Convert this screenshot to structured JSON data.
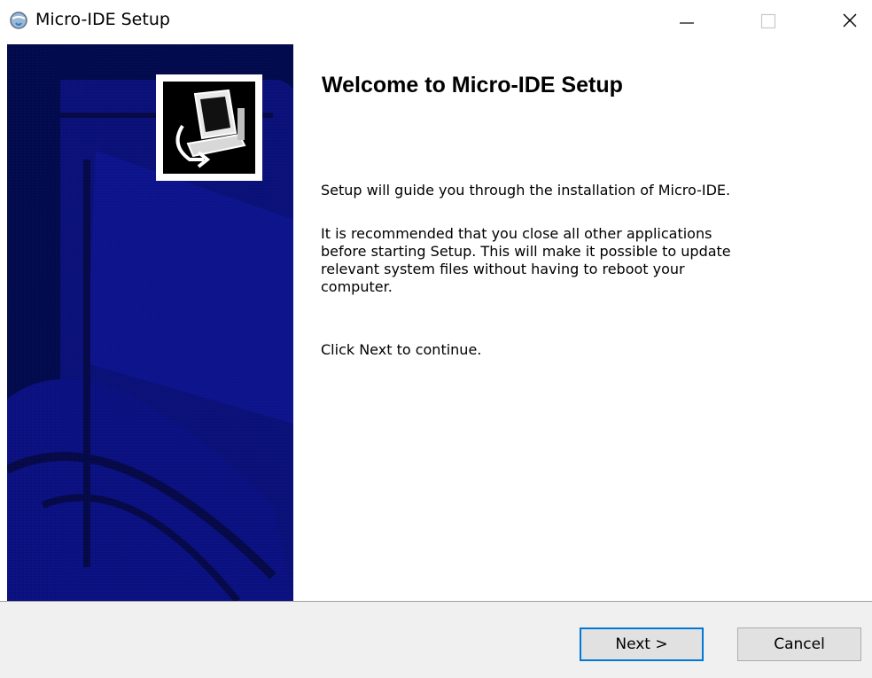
{
  "window": {
    "title": "Micro-IDE Setup"
  },
  "icons": {
    "app": "setup-globe-icon",
    "minimize": "minimize-icon",
    "maximize": "maximize-icon",
    "close": "close-icon",
    "logo": "computer-install-icon"
  },
  "content": {
    "heading": "Welcome to Micro-IDE Setup",
    "intro": "Setup will guide you through the installation of Micro-IDE.",
    "recommendation": "It is recommended that you close all other applications\nbefore starting Setup. This will make it possible to update\nrelevant system files without having to reboot your\ncomputer.",
    "continue_hint": "Click Next to continue."
  },
  "buttons": {
    "next": "Next >",
    "cancel": "Cancel"
  },
  "colors": {
    "sidebar": "#0a0f5e",
    "focus": "#0078d7"
  }
}
